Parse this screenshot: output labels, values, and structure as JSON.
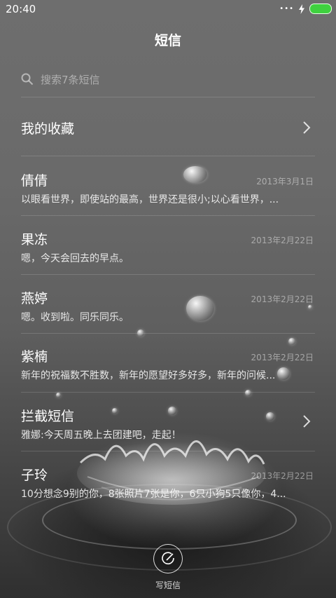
{
  "status_bar": {
    "time": "20:40",
    "battery_color": "#3fd13f"
  },
  "header": {
    "title": "短信"
  },
  "search": {
    "placeholder": "搜索7条短信"
  },
  "favorites": {
    "label": "我的收藏"
  },
  "conversations": [
    {
      "name": "倩倩",
      "date": "2013年3月1日",
      "preview": "以眼看世界，即使站的最高，世界还是很小;以心看世界，..."
    },
    {
      "name": "果冻",
      "date": "2013年2月22日",
      "preview": "嗯，今天会回去的早点。"
    },
    {
      "name": "燕婷",
      "date": "2013年2月22日",
      "preview": "嗯。收到啦。同乐同乐。"
    },
    {
      "name": "紫楠",
      "date": "2013年2月22日",
      "preview": "新年的祝福数不胜数，新年的愿望好多好多，新年的问候..."
    },
    {
      "name": "拦截短信",
      "date": "",
      "preview": "雅娜:今天周五晚上去团建吧，走起！"
    },
    {
      "name": "子玲",
      "date": "2013年2月22日",
      "preview": "10分想念9别的你，8张照片7张是你，6只小狗5只像你，4..."
    }
  ],
  "compose": {
    "label": "写短信"
  }
}
